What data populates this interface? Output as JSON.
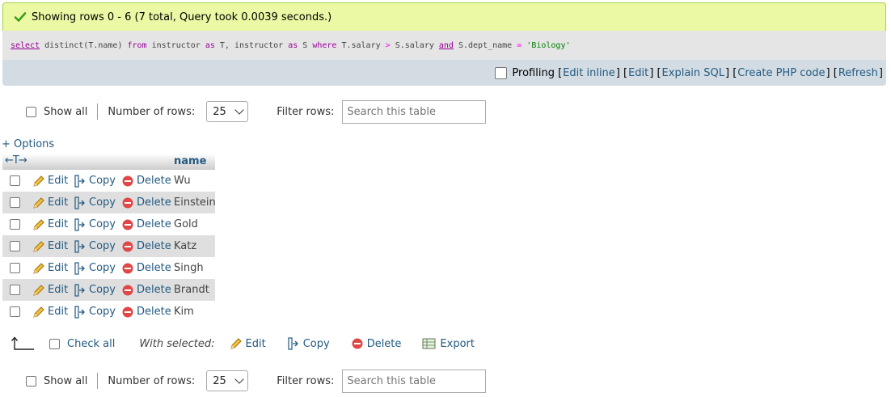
{
  "result": {
    "message": "Showing rows 0 - 6 (7 total, Query took 0.0039 seconds.)"
  },
  "sql": {
    "parts": [
      {
        "t": "select",
        "c": "kwu"
      },
      {
        "t": " distinct(T.name) ",
        "c": ""
      },
      {
        "t": "from",
        "c": "kw"
      },
      {
        "t": " instructor ",
        "c": ""
      },
      {
        "t": "as",
        "c": "kw"
      },
      {
        "t": " T, instructor ",
        "c": ""
      },
      {
        "t": "as",
        "c": "kw"
      },
      {
        "t": " S ",
        "c": ""
      },
      {
        "t": "where",
        "c": "kw"
      },
      {
        "t": " T.salary ",
        "c": ""
      },
      {
        "t": ">",
        "c": "op"
      },
      {
        "t": " S.salary ",
        "c": ""
      },
      {
        "t": "and",
        "c": "kwu"
      },
      {
        "t": " S.dept_name ",
        "c": ""
      },
      {
        "t": "=",
        "c": "op"
      },
      {
        "t": " ",
        "c": ""
      },
      {
        "t": "'Biology'",
        "c": "str"
      }
    ]
  },
  "tools": {
    "profiling": "Profiling",
    "edit_inline": "Edit inline",
    "edit": "Edit",
    "explain": "Explain SQL",
    "php": "Create PHP code",
    "refresh": "Refresh"
  },
  "nav": {
    "show_all": "Show all",
    "rows_label": "Number of rows:",
    "rows_value": "25",
    "filter_label": "Filter rows:",
    "filter_placeholder": "Search this table"
  },
  "options_label": "+ Options",
  "table": {
    "column": "name",
    "arrows": "←T→",
    "actions": {
      "edit": "Edit",
      "copy": "Copy",
      "delete": "Delete"
    },
    "rows": [
      "Wu",
      "Einstein",
      "Gold",
      "Katz",
      "Singh",
      "Brandt",
      "Kim"
    ]
  },
  "bulk": {
    "check_all": "Check all",
    "with_selected": "With selected:",
    "edit": "Edit",
    "copy": "Copy",
    "delete": "Delete",
    "export": "Export"
  },
  "colors": {
    "success_bg": "#ebf8a4",
    "link": "#235a81",
    "toolbar_bg": "#d3dce3",
    "row_alt": "#dfdfdf"
  }
}
